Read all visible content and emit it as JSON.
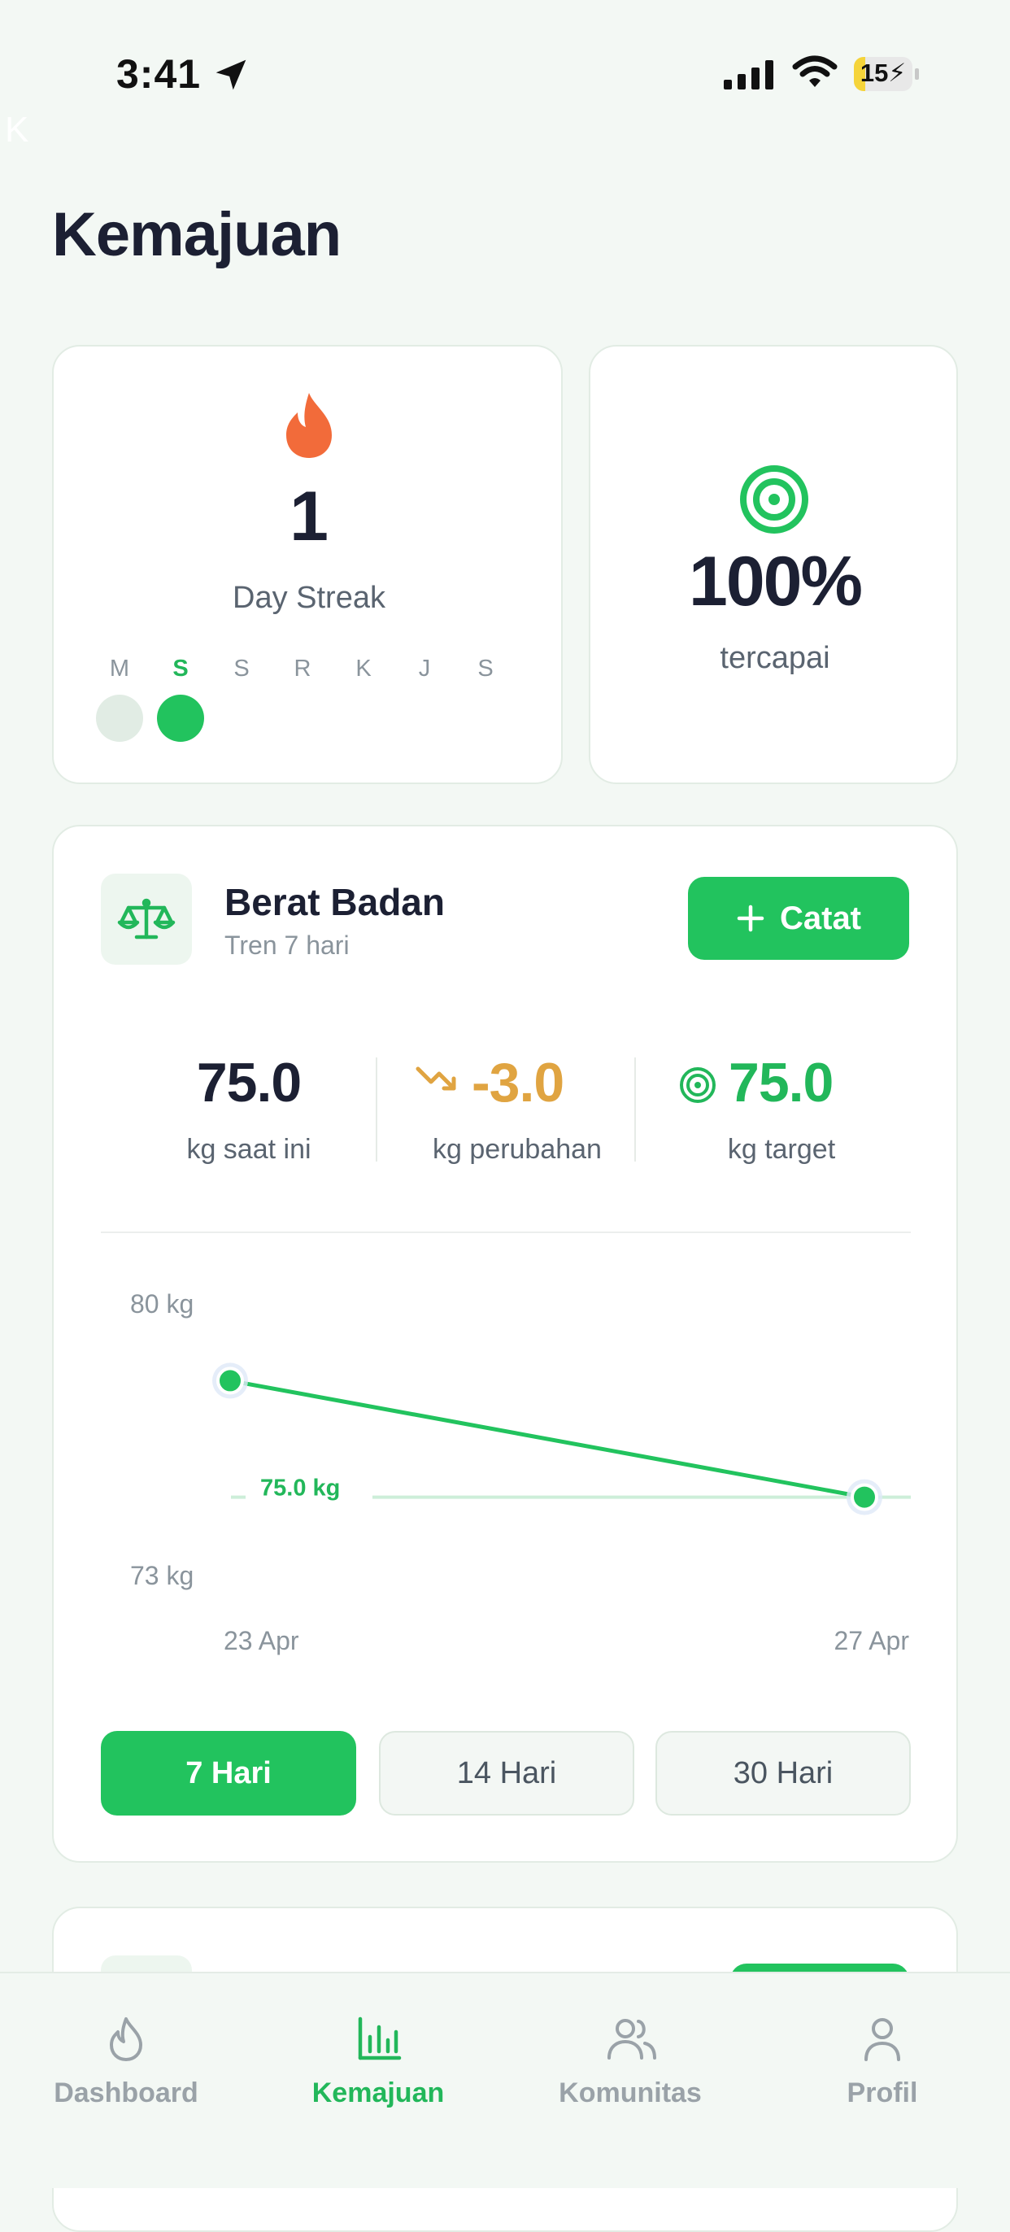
{
  "status_bar": {
    "time": "3:41",
    "battery": "15"
  },
  "corner_letter": "K",
  "page_title": "Kemajuan",
  "streak": {
    "count": "1",
    "label": "Day Streak",
    "days": [
      {
        "letter": "M",
        "state": "past"
      },
      {
        "letter": "S",
        "state": "today"
      },
      {
        "letter": "S",
        "state": "none"
      },
      {
        "letter": "R",
        "state": "none"
      },
      {
        "letter": "K",
        "state": "none"
      },
      {
        "letter": "J",
        "state": "none"
      },
      {
        "letter": "S",
        "state": "none"
      }
    ]
  },
  "goal": {
    "value": "100%",
    "label": "tercapai"
  },
  "weight": {
    "title": "Berat Badan",
    "subtitle": "Tren 7 hari",
    "add_button": "Catat",
    "stats": {
      "current": {
        "value": "75.0",
        "label": "kg saat ini"
      },
      "change": {
        "value": "-3.0",
        "label": "kg perubahan"
      },
      "target": {
        "value": "75.0",
        "label": "kg target"
      }
    },
    "ranges": [
      {
        "label": "7 Hari",
        "active": true
      },
      {
        "label": "14 Hari",
        "active": false
      },
      {
        "label": "30 Hari",
        "active": false
      }
    ]
  },
  "chart_data": {
    "type": "line",
    "x": [
      "23 Apr",
      "27 Apr"
    ],
    "series": [
      {
        "values": [
          78.0,
          75.0
        ]
      }
    ],
    "y_tick_labels": [
      "80 kg",
      "73 kg"
    ],
    "ylim": [
      73,
      80
    ],
    "target_line": {
      "value": 75.0,
      "label": "75.0 kg"
    },
    "grid": false
  },
  "tabs": [
    {
      "label": "Dashboard",
      "icon": "flame-icon",
      "active": false
    },
    {
      "label": "Kemajuan",
      "icon": "bar-chart-icon",
      "active": true
    },
    {
      "label": "Komunitas",
      "icon": "users-icon",
      "active": false
    },
    {
      "label": "Profil",
      "icon": "user-icon",
      "active": false
    }
  ],
  "colors": {
    "accent": "#22c35e",
    "flame": "#f26b3a",
    "change": "#e0a441",
    "text_dark": "#1c2033",
    "muted": "#8a949c",
    "background": "#f3f8f4"
  }
}
